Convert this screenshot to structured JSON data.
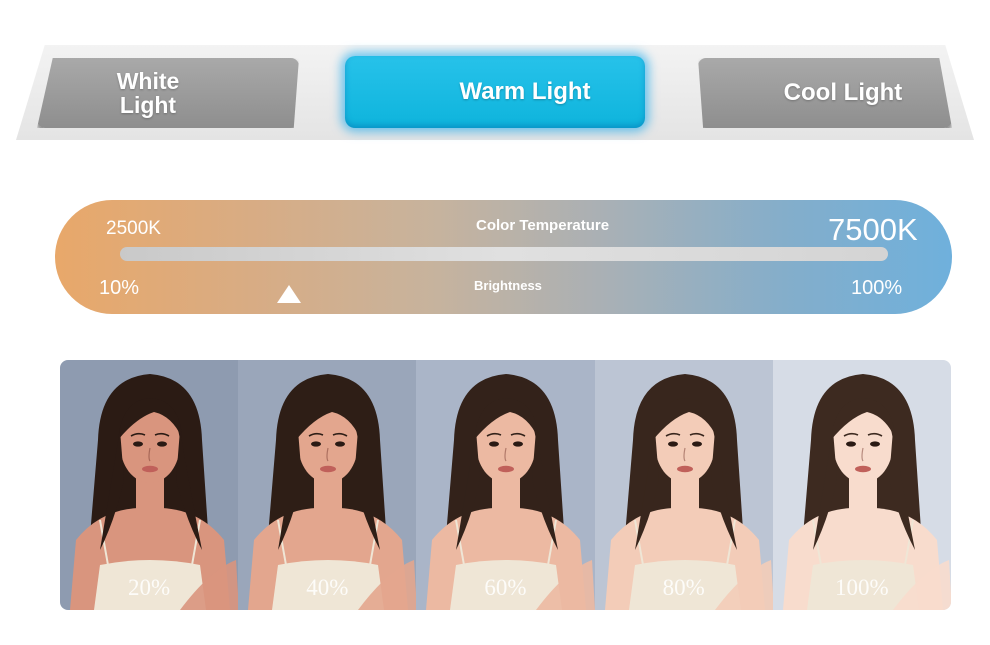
{
  "modes": {
    "white_light": "White Light",
    "warm_light": "Warm Light",
    "cool_light": "Cool Light",
    "selected": "Warm Light"
  },
  "color_temperature": {
    "title": "Color Temperature",
    "min_label": "2500K",
    "max_label": "7500K"
  },
  "brightness": {
    "title": "Brightness",
    "min_label": "10%",
    "max_label": "100%",
    "level_fraction": 0.22
  },
  "samples": [
    {
      "label": "20%",
      "background": "#8e9bb0"
    },
    {
      "label": "40%",
      "background": "#9aa6ba"
    },
    {
      "label": "60%",
      "background": "#aab5c8"
    },
    {
      "label": "80%",
      "background": "#bcc5d4"
    },
    {
      "label": "100%",
      "background": "#d6dce6"
    }
  ],
  "colors": {
    "accent": "#18bbe2",
    "warm_end": "#e8a86a",
    "cool_end": "#6fb0dc",
    "inactive_button": "#9a9a9a"
  }
}
